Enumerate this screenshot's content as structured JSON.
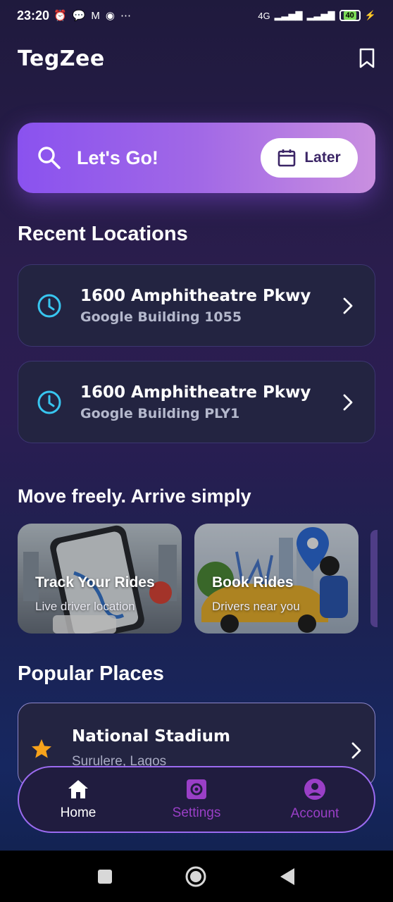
{
  "status_bar": {
    "time": "23:20",
    "network": "4G",
    "battery": "40"
  },
  "app": {
    "title": "TegZee"
  },
  "search": {
    "label": "Let's Go!",
    "later_label": "Later"
  },
  "recent": {
    "title": "Recent Locations",
    "items": [
      {
        "title": "1600 Amphitheatre Pkwy",
        "subtitle": "Google Building 1055"
      },
      {
        "title": "1600 Amphitheatre Pkwy",
        "subtitle": "Google Building PLY1"
      }
    ]
  },
  "features": {
    "title": "Move freely. Arrive simply",
    "items": [
      {
        "title": "Track Your Rides",
        "subtitle": "Live driver location"
      },
      {
        "title": "Book Rides",
        "subtitle": "Drivers near you"
      }
    ]
  },
  "popular": {
    "title": "Popular Places",
    "items": [
      {
        "title": "National Stadium",
        "subtitle": "Surulere, Lagos"
      }
    ]
  },
  "nav": {
    "home": "Home",
    "settings": "Settings",
    "account": "Account"
  },
  "colors": {
    "accent": "#9b6bf0",
    "inactive_nav": "#9a3fc7",
    "clock_icon": "#38c6f0",
    "star": "#f7a21b"
  }
}
